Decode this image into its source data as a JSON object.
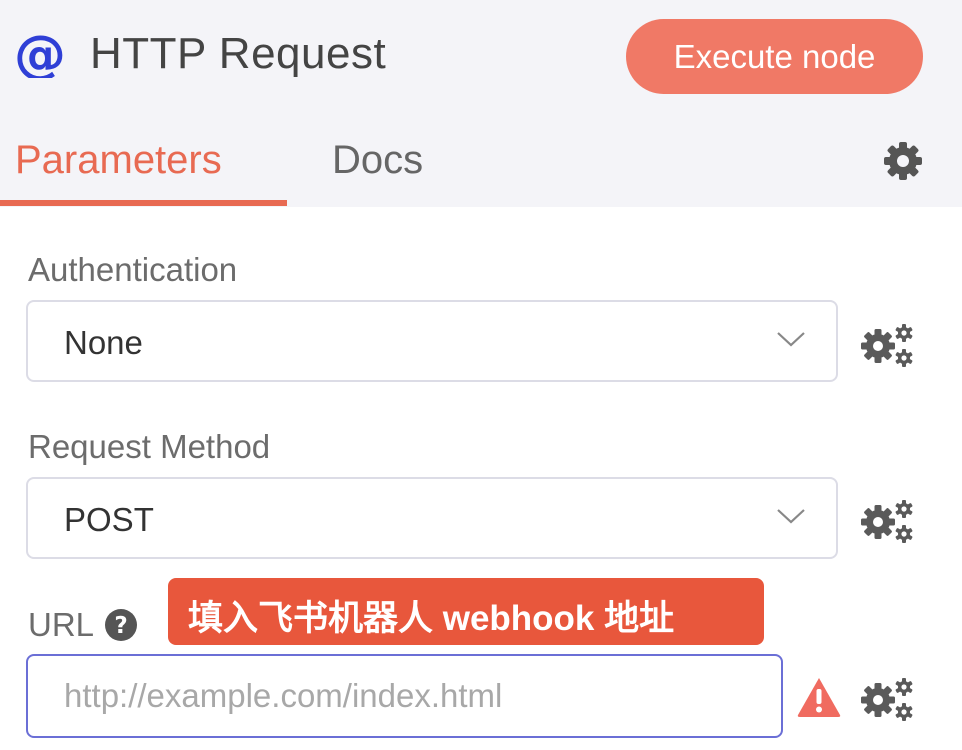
{
  "header": {
    "icon": "at-sign-icon",
    "title": "HTTP Request",
    "execute_label": "Execute node"
  },
  "tabs": [
    {
      "label": "Parameters",
      "active": true
    },
    {
      "label": "Docs",
      "active": false
    }
  ],
  "colors": {
    "accent": "#e86a52",
    "button": "#f07966",
    "tooltip": "#e8573c",
    "icon_blue": "#2f3fd6",
    "warning": "#f06b60"
  },
  "fields": {
    "authentication": {
      "label": "Authentication",
      "value": "None"
    },
    "request_method": {
      "label": "Request Method",
      "value": "POST"
    },
    "url": {
      "label": "URL",
      "value": "",
      "placeholder": "http://example.com/index.html"
    }
  },
  "tooltip": {
    "text": "填入飞书机器人 webhook 地址"
  }
}
